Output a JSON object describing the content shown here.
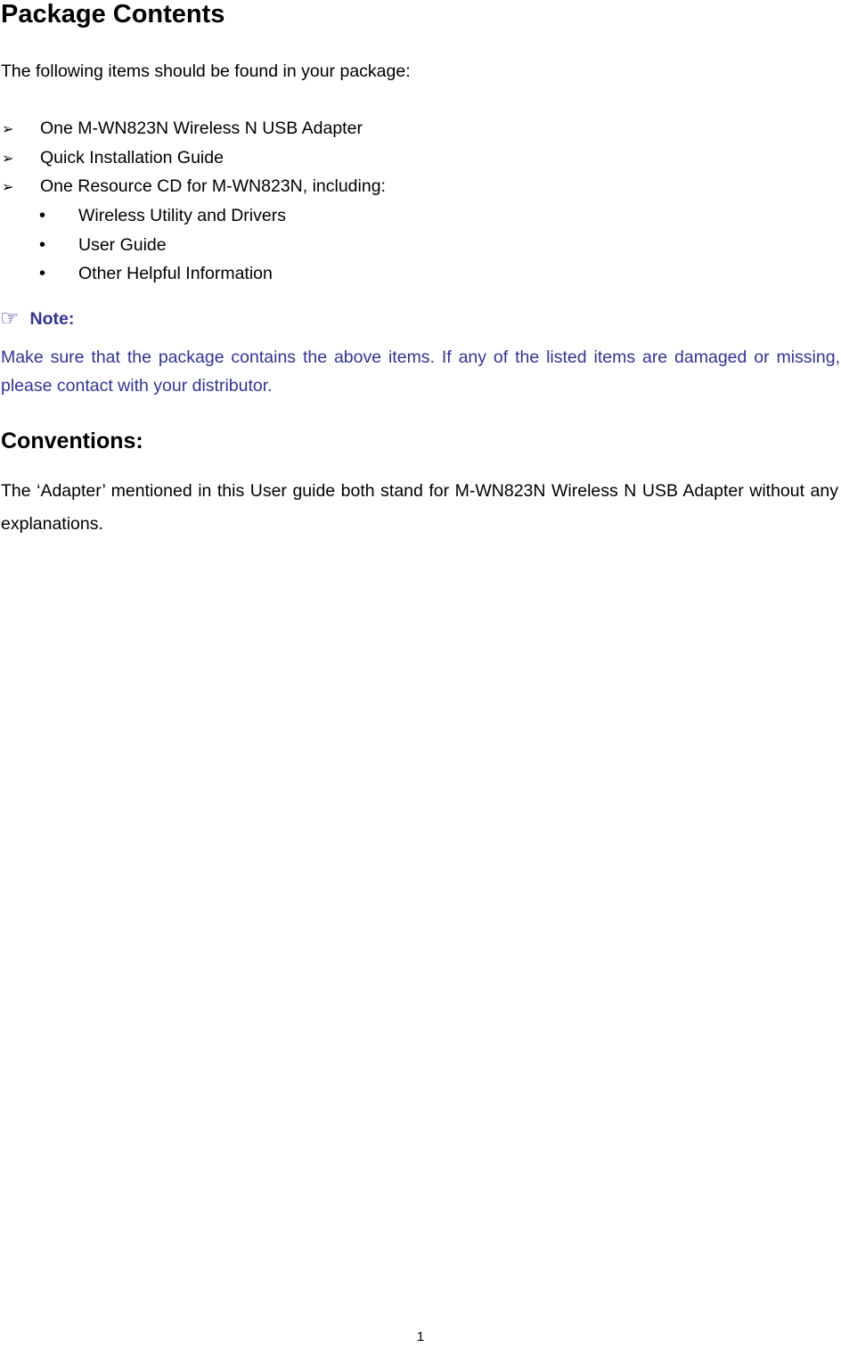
{
  "title": "Package Contents",
  "intro": "The following items should be found in your package:",
  "items": [
    {
      "marker": "➢",
      "text": "One M-WN823N Wireless N USB Adapter"
    },
    {
      "marker": "➢",
      "text": "Quick Installation Guide"
    },
    {
      "marker": "➢",
      "text": "One Resource CD for M-WN823N, including:"
    }
  ],
  "sub_items": [
    {
      "marker": "•",
      "text": "Wireless Utility and Drivers"
    },
    {
      "marker": "•",
      "text": "User Guide"
    },
    {
      "marker": "•",
      "text": "Other Helpful Information"
    }
  ],
  "note": {
    "icon": "pointing-hand-icon",
    "label": "Note:",
    "text": "Make sure that the package contains the above items. If any of the listed items are damaged or missing, please contact with your distributor.",
    "color": "#333399"
  },
  "conventions": {
    "title": "Conventions:",
    "text": "The ‘Adapter’ mentioned in this User guide both stand for M-WN823N Wireless N USB Adapter without any explanations."
  },
  "page_number": "1"
}
